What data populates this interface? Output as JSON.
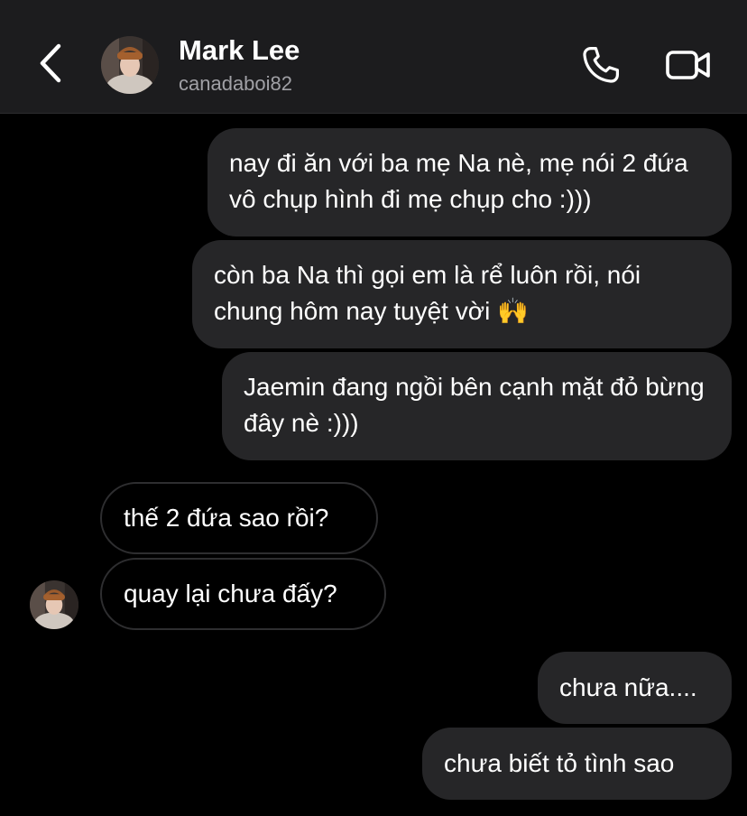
{
  "header": {
    "name": "Mark Lee",
    "username": "canadaboi82"
  },
  "messages": [
    {
      "direction": "outgoing",
      "text": "nay đi ăn với ba mẹ Na nè, mẹ nói 2 đứa vô chụp hình đi mẹ chụp cho :)))"
    },
    {
      "direction": "outgoing",
      "text": "còn ba Na thì gọi em là rể luôn rồi, nói chung hôm nay tuyệt vời",
      "emoji": "🙌"
    },
    {
      "direction": "outgoing",
      "text": "Jaemin đang ngồi bên cạnh mặt đỏ bừng đây nè :)))"
    },
    {
      "direction": "incoming",
      "text": "thế 2 đứa sao rồi?"
    },
    {
      "direction": "incoming",
      "text": "quay lại chưa đấy?"
    },
    {
      "direction": "outgoing",
      "text": "chưa nữa...."
    },
    {
      "direction": "outgoing",
      "text": "chưa biết tỏ tình sao"
    }
  ],
  "icons": {
    "back": "chevron-left-icon",
    "call": "phone-icon",
    "video": "video-camera-icon"
  },
  "colors": {
    "background": "#000000",
    "header_background": "#1c1c1e",
    "outgoing_bubble": "#262628",
    "incoming_border": "#2e2e30",
    "secondary_text": "#a0a0a5"
  }
}
